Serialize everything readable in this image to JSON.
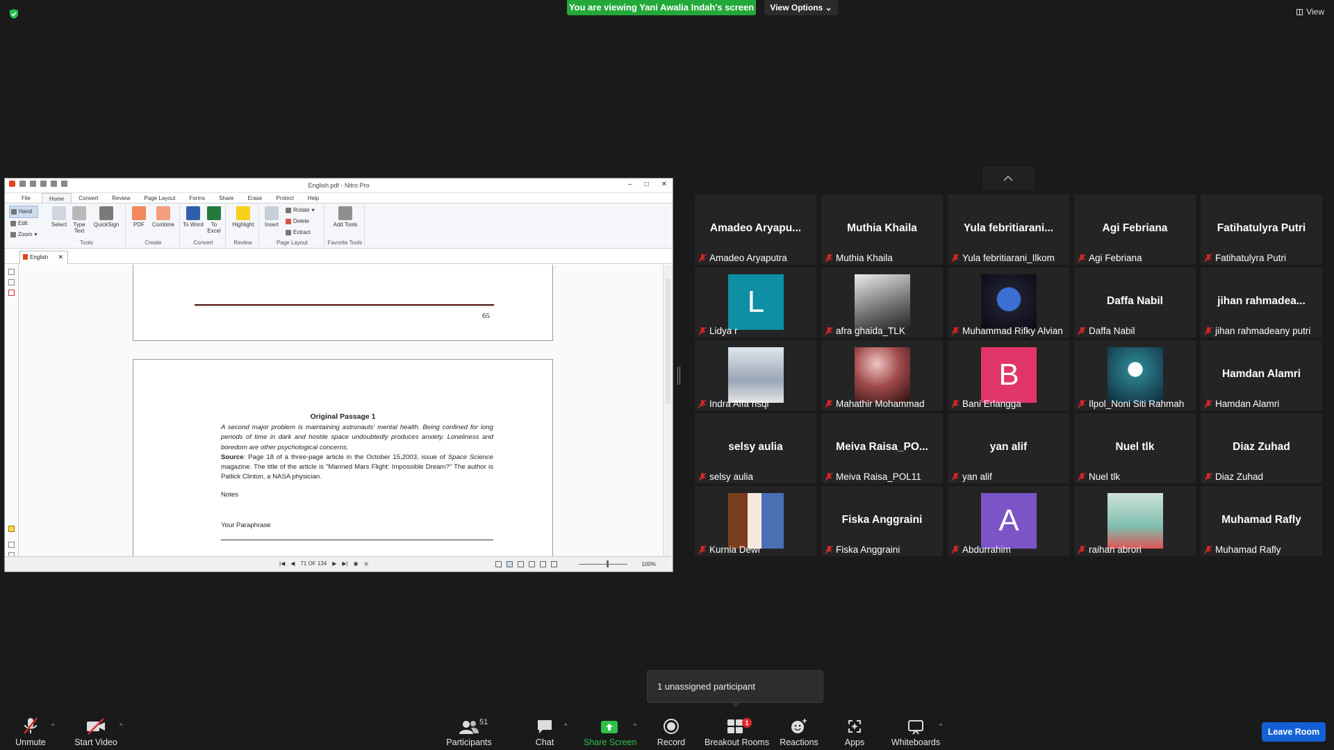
{
  "top": {
    "banner": "You are viewing Yani Awalia Indah's screen",
    "view_options": "View Options",
    "view_label": "View"
  },
  "nitro": {
    "title": "English.pdf - Nitro Pro",
    "tabs": [
      "File",
      "Home",
      "Convert",
      "Review",
      "Page Layout",
      "Forms",
      "Share",
      "Erase",
      "Protect",
      "Help"
    ],
    "ribbon": {
      "hand": "Hand",
      "edit": "Edit",
      "zoom": "Zoom",
      "select": "Select",
      "type_text": "Type Text",
      "quicksign": "QuickSign",
      "pdf": "PDF",
      "combine": "Combine",
      "to_word": "To Word",
      "to_excel": "To Excel",
      "highlight": "Highlight",
      "insert": "Insert",
      "rotate": "Rotate",
      "delete": "Delete",
      "extract": "Extract",
      "add_tools": "Add Tools",
      "groups": [
        "Tools",
        "Create",
        "Convert",
        "Review",
        "Page Layout",
        "Favorite Tools"
      ]
    },
    "doc_tab": "English",
    "page_number": "65",
    "passage_title": "Original Passage 1",
    "passage_italic": "A second major problem is maintaining astronauts' mental health. Being confined for long periods of time in dark and hostile space undoubtedly produces anxiety. Loneliness and boredom are other psychological concerns.",
    "source_label": "Source",
    "source_text_a": ": Page 18 of a three-page article in the October 15,2003, issue of ",
    "source_magazine": "Space Science",
    "source_text_b": " magazine. The title of the article is \"Manned Mars Flight: Impossible Dream?\" The author is Patlick Clinton, a NASA physician.",
    "notes": "Notes",
    "paraphrase": "Your Paraphrase",
    "page_indicator": "71 OF 134",
    "zoom": "100%"
  },
  "participants": [
    {
      "big": "Amadeo  Aryapu...",
      "name": "Amadeo Aryaputra"
    },
    {
      "big": "Muthia Khaila",
      "name": "Muthia Khaila"
    },
    {
      "big": "Yula  febritiarani...",
      "name": "Yula febritiarani_Ilkom"
    },
    {
      "big": "Agi Febriana",
      "name": "Agi Febriana"
    },
    {
      "big": "Fatihatulyra Putri",
      "name": "Fatihatulyra Putri"
    },
    {
      "avatar": "L",
      "name": "Lidya r"
    },
    {
      "name": "afra ghaida_TLK"
    },
    {
      "name": "Muhammad Rifky Alvian"
    },
    {
      "big": "Daffa Nabil",
      "name": "Daffa Nabil"
    },
    {
      "big": "jihan  rahmadea...",
      "name": "jihan rahmadeany putri"
    },
    {
      "name": "Indra Alfa risqi"
    },
    {
      "name": "Mahathir Mohammad"
    },
    {
      "avatar": "B",
      "name": "Bani Erlangga"
    },
    {
      "name": "Ilpol_Noni Siti Rahmah"
    },
    {
      "big": "Hamdan Alamri",
      "name": "Hamdan Alamri"
    },
    {
      "big": "selsy aulia",
      "name": "selsy aulia"
    },
    {
      "big": "Meiva  Raisa_PO...",
      "name": "Meiva Raisa_POL11"
    },
    {
      "big": "yan alif",
      "name": "yan alif"
    },
    {
      "big": "Nuel tlk",
      "name": "Nuel tlk"
    },
    {
      "big": "Diaz Zuhad",
      "name": "Diaz Zuhad"
    },
    {
      "name": "Kurnia Dewi"
    },
    {
      "big": "Fiska Anggraini",
      "name": "Fiska Anggraini"
    },
    {
      "avatar": "A",
      "name": "Abdurrahim"
    },
    {
      "name": "raihan abrori"
    },
    {
      "big": "Muhamad Rafly",
      "name": "Muhamad Rafly"
    }
  ],
  "popup": "1 unassigned participant",
  "toolbar": {
    "unmute": "Unmute",
    "start_video": "Start Video",
    "participants": "Participants",
    "participants_count": "51",
    "chat": "Chat",
    "share_screen": "Share Screen",
    "record": "Record",
    "breakout": "Breakout Rooms",
    "breakout_badge": "1",
    "reactions": "Reactions",
    "apps": "Apps",
    "whiteboards": "Whiteboards",
    "leave": "Leave Room"
  },
  "colors": {
    "accent_green": "#23a83a",
    "leave_blue": "#1261d6",
    "mic_muted": "#e02828"
  }
}
